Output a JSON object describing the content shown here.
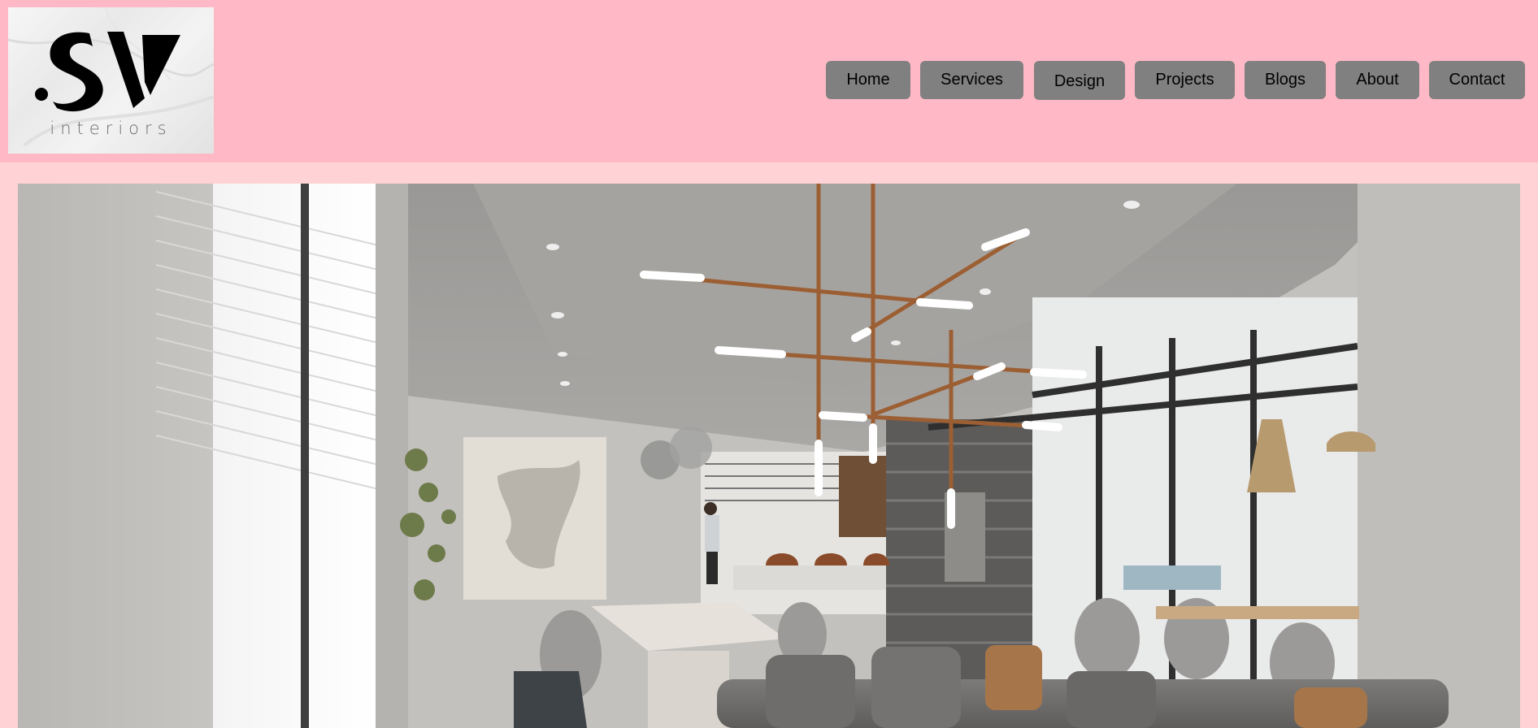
{
  "brand": {
    "monogram": "SV",
    "wordmark": "interiors"
  },
  "nav": {
    "items": [
      {
        "label": "Home"
      },
      {
        "label": "Services"
      },
      {
        "label": "Design"
      },
      {
        "label": "Projects"
      },
      {
        "label": "Blogs"
      },
      {
        "label": "About"
      },
      {
        "label": "Contact"
      }
    ]
  },
  "hero": {
    "image": "interior-dining-living-room-photo"
  },
  "colors": {
    "header_bg": "#ffb9c6",
    "page_bg": "#ffd2d5",
    "nav_button_bg": "#808080"
  }
}
